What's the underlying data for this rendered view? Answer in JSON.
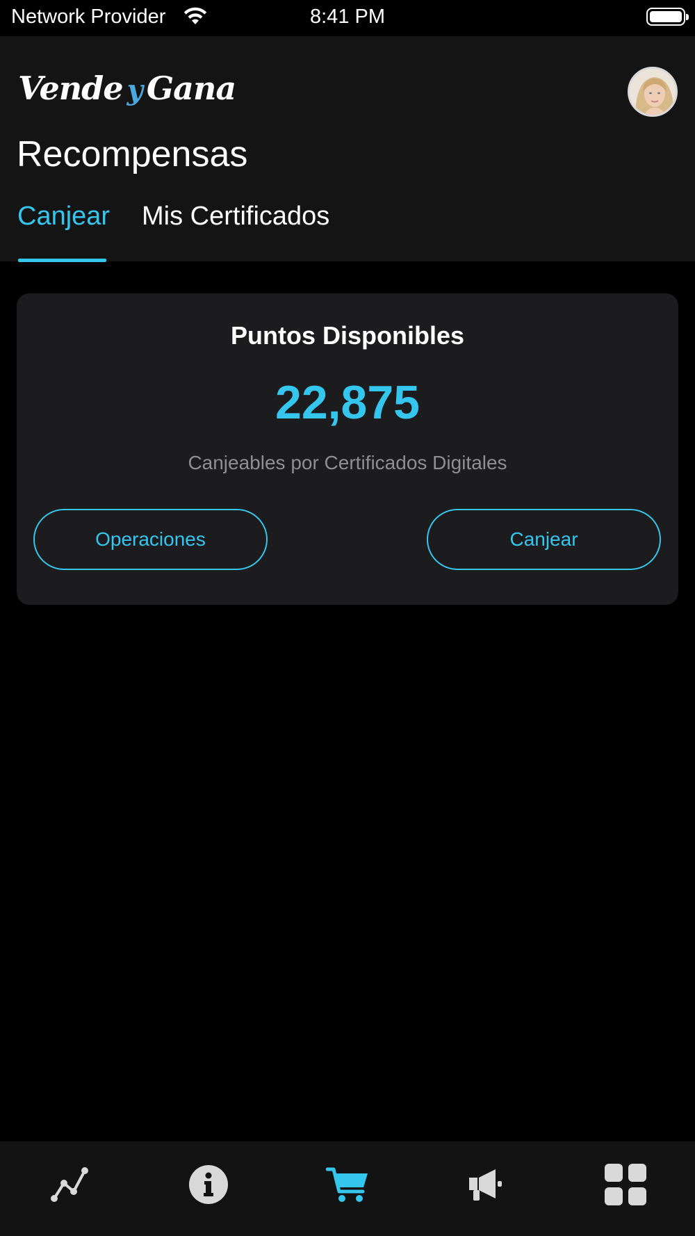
{
  "status_bar": {
    "carrier": "Network Provider",
    "time": "8:41 PM",
    "wifi_icon": "wifi-icon",
    "battery_icon": "battery-full-icon"
  },
  "header": {
    "logo_part1": "Vende",
    "logo_part2": "y",
    "logo_part3": "Gana",
    "avatar_icon": "user-avatar",
    "title": "Recompensas"
  },
  "tabs": [
    {
      "label": "Canjear",
      "active": true
    },
    {
      "label": "Mis Certificados",
      "active": false
    }
  ],
  "points_card": {
    "title": "Puntos Disponibles",
    "points": "22,875",
    "subtitle": "Canjeables por Certificados Digitales",
    "operations_label": "Operaciones",
    "redeem_label": "Canjear"
  },
  "bottom_nav": [
    {
      "icon": "trend-line-icon",
      "active": false
    },
    {
      "icon": "info-icon",
      "active": false
    },
    {
      "icon": "cart-icon",
      "active": true
    },
    {
      "icon": "megaphone-icon",
      "active": false
    },
    {
      "icon": "grid-icon",
      "active": false
    }
  ],
  "colors": {
    "accent": "#35c6ee",
    "background": "#000000",
    "header_bg": "#141414",
    "card_bg": "#1c1c1e",
    "icon_inactive": "#d9d9d9",
    "subtitle": "#8e8e93"
  }
}
